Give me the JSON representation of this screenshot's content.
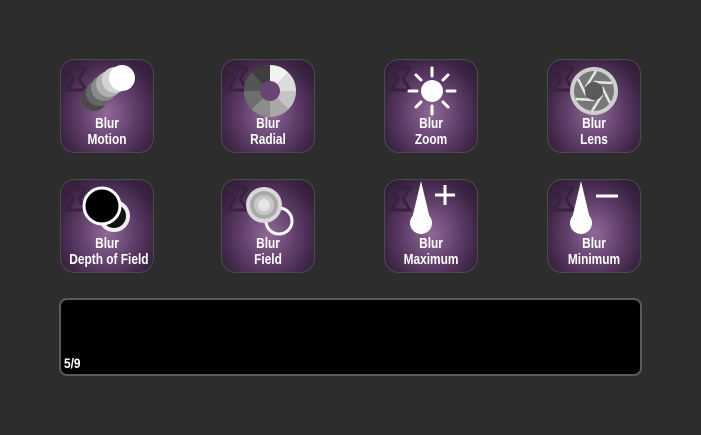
{
  "buttons": [
    {
      "line1": "Blur",
      "line2": "Motion",
      "icon": "blur-motion-icon"
    },
    {
      "line1": "Blur",
      "line2": "Radial",
      "icon": "blur-radial-icon"
    },
    {
      "line1": "Blur",
      "line2": "Zoom",
      "icon": "blur-zoom-icon"
    },
    {
      "line1": "Blur",
      "line2": "Lens",
      "icon": "blur-lens-icon"
    },
    {
      "line1": "Blur",
      "line2": "Depth of Field",
      "icon": "blur-depth-of-field-icon"
    },
    {
      "line1": "Blur",
      "line2": "Field",
      "icon": "blur-field-icon"
    },
    {
      "line1": "Blur",
      "line2": "Maximum",
      "icon": "blur-maximum-icon"
    },
    {
      "line1": "Blur",
      "line2": "Minimum",
      "icon": "blur-minimum-icon"
    }
  ],
  "status": {
    "page": "5/9"
  },
  "colors": {
    "background": "#2d2d2d",
    "key_purple": "#5e3c68",
    "logo": "#3a2140",
    "panel": "#000000"
  }
}
